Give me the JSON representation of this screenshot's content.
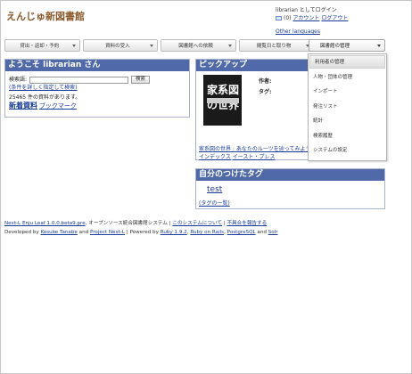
{
  "header": {
    "site_title": "えんじゅ新図書館",
    "login_text": "librarian としてログイン",
    "mail_count": "(0)",
    "account_link": "アカウント",
    "logout_link": "ログアウト",
    "other_languages": "Other languages"
  },
  "nav": {
    "items": [
      "貸出・返却・予約",
      "資料の受入",
      "図書館への依頼",
      "閲覧日と取り物"
    ],
    "admin_menu": "図書館の管理"
  },
  "dropdown": {
    "items": [
      "利用者の管理",
      "人物・団体の管理",
      "インポート",
      "発注リスト",
      "統計",
      "検索履歴",
      "システムの設定"
    ]
  },
  "welcome": {
    "title": "ようこそ librarian さん",
    "search_label": "検索語:",
    "search_value": "",
    "search_button": "検索",
    "advanced_search": "(条件を詳しく指定して検索)",
    "count_text": "25465 件の資料があります。",
    "new_items": "新着資料",
    "bookmarks": "ブックマーク"
  },
  "pickup": {
    "title": "ピックアップ",
    "cover_title": "家系図の世界",
    "author_label": "作者:",
    "tags_label": "タグ:",
    "book_title": "家系図の世界 : あなたのルーツを辿ってみよう",
    "publisher_1": "インデックス",
    "publisher_2": "イースト・プレス"
  },
  "my_tags": {
    "title": "自分のつけたタグ",
    "tag": "test",
    "tag_list_link": "(タグの一覧)"
  },
  "footer": {
    "line1_link1": "Next-L Enju Leaf 1.0.0.beta9.pre",
    "line1_text": ", オープンソース統合図書館システム | ",
    "line1_link2": "このシステムについて",
    "line1_sep": " | ",
    "line1_link3": "不具合を報告する",
    "line2_prefix": "Developed by ",
    "line2_link1": "Kosuke Tanabe",
    "line2_and": " and ",
    "line2_link2": "Project Next-L",
    "line2_powered": " | Powered by ",
    "line2_link3": "Ruby 1.9.2",
    "line2_comma1": ", ",
    "line2_link4": "Ruby on Rails",
    "line2_comma2": ", ",
    "line2_link5": "PostgreSQL",
    "line2_and2": " and ",
    "line2_link6": "Solr"
  }
}
